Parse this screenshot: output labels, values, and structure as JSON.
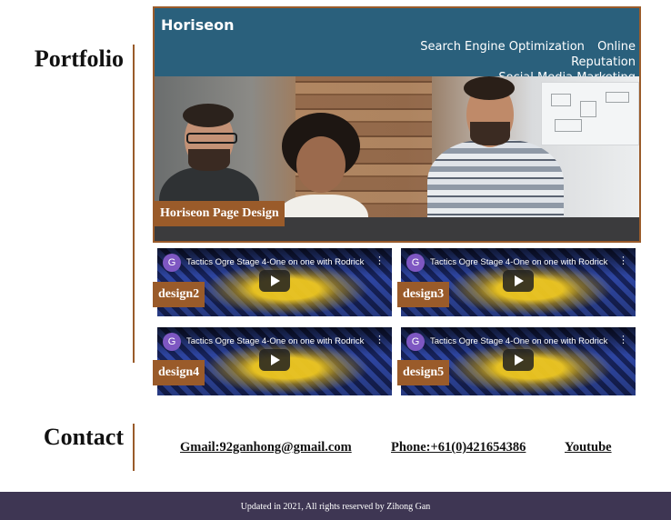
{
  "portfolio": {
    "heading": "Portfolio",
    "featured": {
      "site_logo": "Horiseon",
      "nav": [
        "Search Engine Optimization",
        "Online Reputation",
        "Social Media Marketing"
      ],
      "label": "Horiseon Page Design"
    },
    "video_title": "Tactics Ogre Stage 4-One on one with Rodrick",
    "video_channel_initial": "G",
    "projects": [
      {
        "label": "design2"
      },
      {
        "label": "design3"
      },
      {
        "label": "design4"
      },
      {
        "label": "design5"
      }
    ]
  },
  "contact": {
    "heading": "Contact",
    "email": "Gmail:92ganhong@gmail.com",
    "phone": "Phone:+61(0)421654386",
    "youtube": "Youtube"
  },
  "footer": {
    "text": "Updated in 2021, All rights reserved by Zihong Gan"
  },
  "colors": {
    "accent": "#9a5b2a",
    "header_blue": "#2a607c",
    "footer_bg": "#3e3653"
  }
}
